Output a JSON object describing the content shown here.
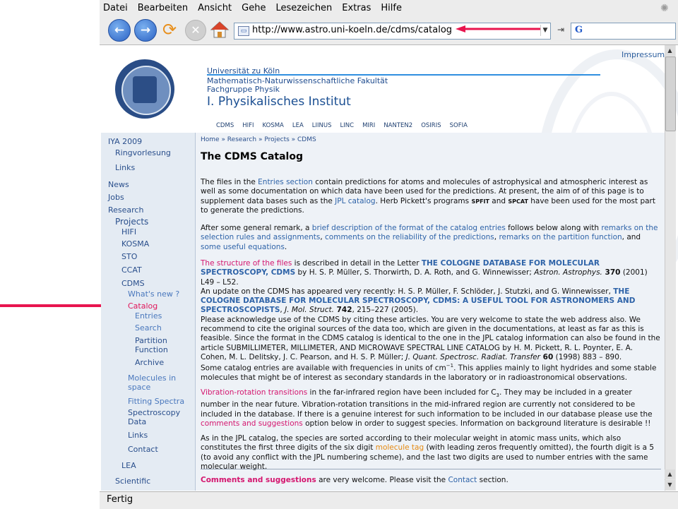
{
  "menu": [
    "Datei",
    "Bearbeiten",
    "Ansicht",
    "Gehe",
    "Lesezeichen",
    "Extras",
    "Hilfe"
  ],
  "url": "http://www.astro.uni-koeln.de/cdms/catalog",
  "search_icon": "G",
  "status": "Fertig",
  "header": {
    "impressum": "Impressum",
    "university": "Universität zu Köln",
    "faculty": "Mathematisch-Naturwissenschaftliche Fakultät",
    "group": "Fachgruppe Physik",
    "institute": "I. Physikalisches Institut",
    "topnav": [
      "CDMS",
      "HIFI",
      "KOSMA",
      "LEA",
      "LIINUS",
      "LINC",
      "MIRI",
      "NANTEN2",
      "OSIRIS",
      "SOFIA"
    ]
  },
  "sidebar": {
    "iya": "IYA 2009",
    "ringvorlesung": "Ringvorlesung",
    "links": "Links",
    "news": "News",
    "jobs": "Jobs",
    "research": "Research",
    "projects": "Projects",
    "hifi": "HIFI",
    "kosma": "KOSMA",
    "sto": "STO",
    "ccat": "CCAT",
    "cdms": "CDMS",
    "whatsnew": "What's new ?",
    "catalog": "Catalog",
    "entries": "Entries",
    "search": "Search",
    "partition1": "Partition",
    "partition2": "Function",
    "archive": "Archive",
    "molecules1": "Molecules in",
    "molecules2": "space",
    "fitting": "Fitting Spectra",
    "spectroscopy1": "Spectroscopy",
    "spectroscopy2": "Data",
    "links2": "Links",
    "contact": "Contact",
    "lea": "LEA",
    "scientific": "Scientific"
  },
  "breadcrumb": "Home » Research » Projects » CDMS",
  "title": "The CDMS Catalog",
  "p1": {
    "t1": "The files in the ",
    "l1": "Entries section",
    "t2": " contain predictions for atoms and molecules of astrophysical and atmospheric interest as well as some documentation on which data have been used for the predictions. At present, the aim of of this page is to supplement data bases such as the ",
    "l2": "JPL catalog",
    "t3": ". Herb Pickett's programs ",
    "spfit": "SPFIT",
    "and": " and ",
    "spcat": "SPCAT",
    "t4": " have been used for the most part to generate the predictions."
  },
  "p2": {
    "t1": "After some general remark, a ",
    "l1": "brief description of the format of the catalog entries",
    "t2": " follows below along with ",
    "l2": "remarks on the selection rules and assignments",
    "t3": ", ",
    "l3": "comments on the reliability of the predictions",
    "t4": ", ",
    "l4": "remarks on the partition function",
    "t5": ", and ",
    "l5": "some useful equations",
    "t6": "."
  },
  "p3": {
    "l1": "The structure of the files",
    "t1": " is described in detail in the Letter ",
    "l2": "THE COLOGNE DATABASE FOR MOLECULAR SPECTROSCOPY, CDMS",
    "t2": " by H. S. P. Müller, S. Thorwirth, D. A. Roth, and G. Winnewisser; ",
    "j1": "Astron. Astrophys.",
    "v1": " 370",
    "t3": " (2001) L49 – L52.",
    "t4": "An update on the CDMS has appeared very recently: H. S. P. Müller, F. Schlöder, J. Stutzki, and G. Winnewisser, ",
    "l3": "THE COLOGNE DATABASE FOR MOLECULAR SPECTROSCOPY, CDMS: A USEFUL TOOL FOR ASTRONOMERS AND SPECTROSCOPISTS",
    "t5": ", ",
    "j2": "J. Mol. Struct.",
    "v2": " 742",
    "t6": ", 215–227 (2005).",
    "t7": "Please acknowledge use of the CDMS by citing these articles. You are very welcome to state the web address also. We recommend to cite the original sources of the data too, which are given in the documentations, at least as far as this is feasible. Since the format in the CDMS catalog is identical to the one in the JPL catalog information can also be found in the article SUBMILLIMETER, MILLIMETER, AND MICROWAVE SPECTRAL LINE CATALOG by H. M. Pickett, R. L. Poynter, E. A. Cohen, M. L. Delitsky, J. C. Pearson, and H. S. P. Müller; ",
    "j3": "J. Quant. Spectrosc. Radiat. Transfer",
    "v3": " 60",
    "t8": " (1998) 883 – 890."
  },
  "p4": {
    "t1": "Some catalog entries are available with frequencies in units of cm",
    "sup": "−1",
    "t2": ". This applies mainly to light hydrides and some stable molecules that might be of interest as secondary standards in the laboratory or in radioastronomical observations."
  },
  "p5": {
    "l1": "Vibration-rotation transitions",
    "t1": " in the far-infrared region have been included for C",
    "sub": "3",
    "t2": ". They may be included in a greater number in the near future. Vibration-rotation transitions in the mid-infrared region are currently not considered to be included in the database. If there is a genuine interest for such information to be included in our database please use the ",
    "l2": "comments and suggestions",
    "t3": " option below in order to suggest species. Information on background literature is desirable !!"
  },
  "p6": {
    "t1": "As in the JPL catalog, the species are sorted according to their molecular weight in atomic mass units, which also constitutes the first three digits of the six digit ",
    "l1": "molecule tag",
    "t2": " (with leading zeros frequently omitted), the fourth digit is a 5 (to avoid any conflict with the JPL numbering scheme), and the last two digits are used to number entries with the same molecular weight."
  },
  "p7": {
    "l1": "Comments and suggestions",
    "t1": " are very welcome. Please visit the ",
    "l2": "Contact",
    "t2": " section."
  },
  "colors": {
    "annotation_arrow": "#e8154f",
    "link": "#2e63a8",
    "highlight": "#d4166f"
  }
}
